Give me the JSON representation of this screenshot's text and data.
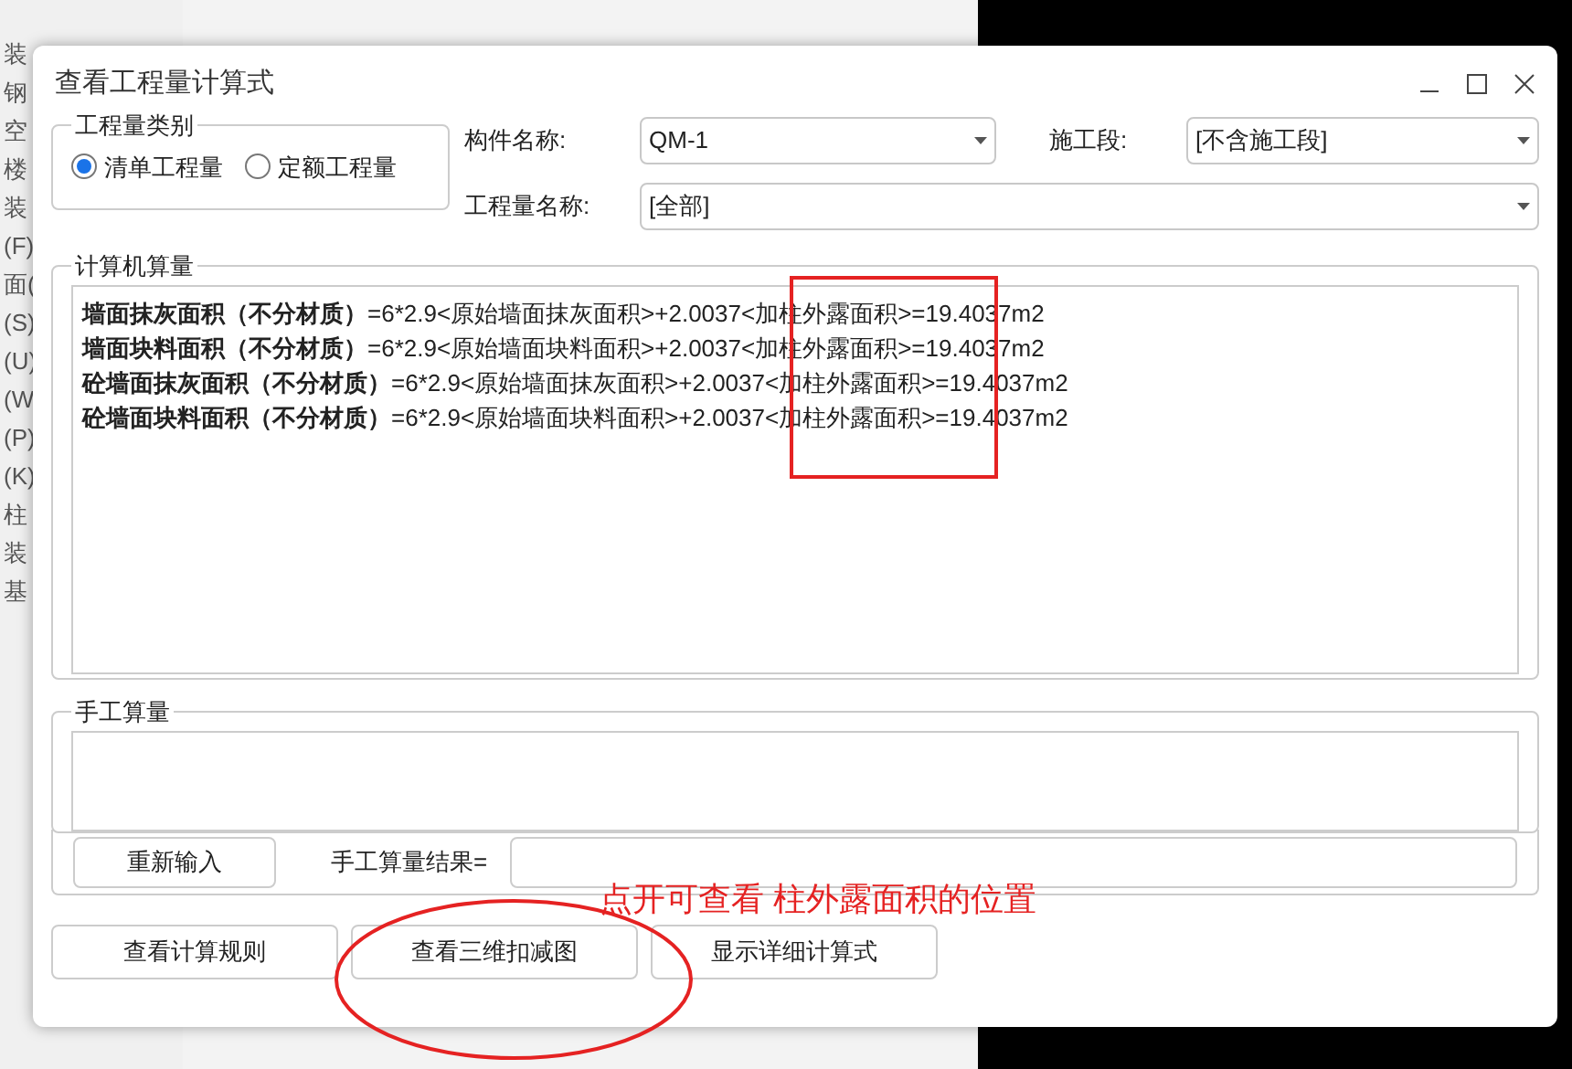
{
  "background": {
    "sidebar_fragments": [
      "装",
      "钢",
      "空",
      "楼",
      "装",
      "(F)",
      "面(",
      "(S)",
      "(U)",
      "(W",
      "(P)",
      "(K)",
      "柱",
      "装",
      "基"
    ]
  },
  "window": {
    "title": "查看工程量计算式"
  },
  "quantity_type": {
    "label": "工程量类别",
    "options": [
      {
        "label": "清单工程量",
        "selected": true
      },
      {
        "label": "定额工程量",
        "selected": false
      }
    ]
  },
  "component_name": {
    "label": "构件名称:",
    "value": "QM-1"
  },
  "construction_stage": {
    "label": "施工段:",
    "value": "[不含施工段]"
  },
  "quantity_name": {
    "label": "工程量名称:",
    "value": "[全部]"
  },
  "computer_calc": {
    "label": "计算机算量",
    "lines": [
      {
        "name": "墙面抹灰面积（不分材质）",
        "formula": "=6*2.9<原始墙面抹灰面积>+2.0037<加柱外露面积>=19.4037m2"
      },
      {
        "name": "墙面块料面积（不分材质）",
        "formula": "=6*2.9<原始墙面块料面积>+2.0037<加柱外露面积>=19.4037m2"
      },
      {
        "name": "砼墙面抹灰面积（不分材质）",
        "formula": "=6*2.9<原始墙面抹灰面积>+2.0037<加柱外露面积>=19.4037m2"
      },
      {
        "name": "砼墙面块料面积（不分材质）",
        "formula": "=6*2.9<原始墙面块料面积>+2.0037<加柱外露面积>=19.4037m2"
      }
    ]
  },
  "manual_calc": {
    "label": "手工算量",
    "reset_button": "重新输入",
    "result_label": "手工算量结果="
  },
  "buttons": [
    "查看计算规则",
    "查看三维扣减图",
    "显示详细计算式"
  ],
  "annotation": {
    "text": "点开可查看 柱外露面积的位置"
  }
}
